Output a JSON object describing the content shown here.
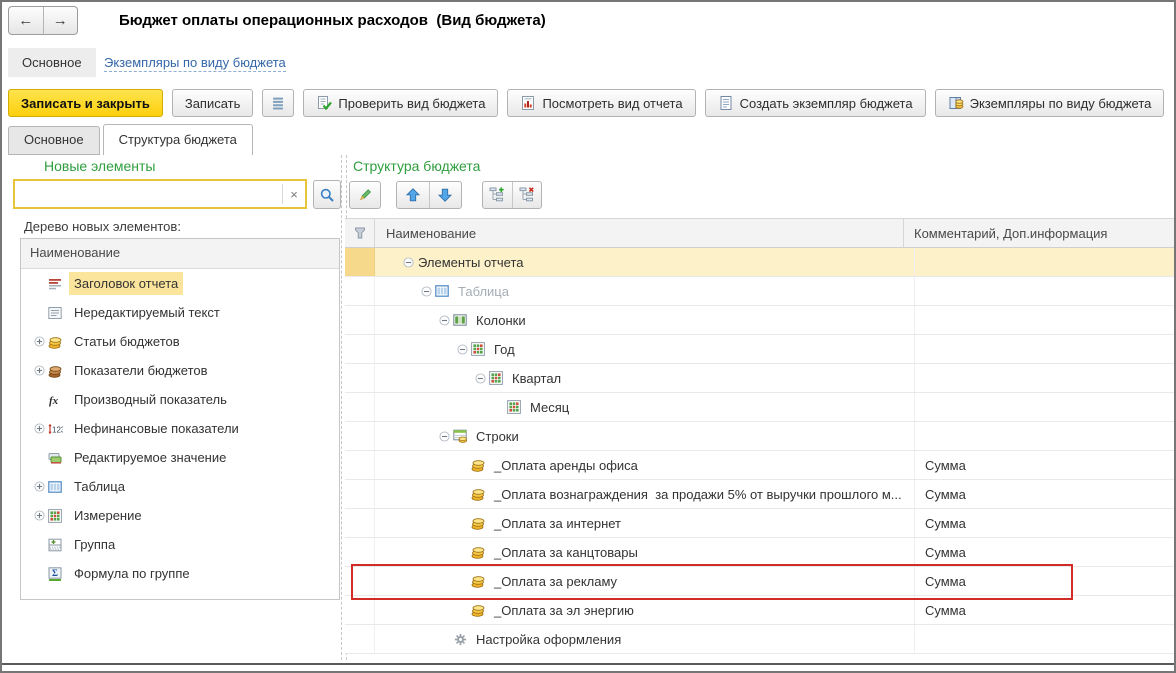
{
  "colors": {
    "accent_green": "#2f9e3f",
    "selection_yellow": "#fbe49c",
    "row_selection": "#fdf1c9",
    "row_selection_dark": "#f6d98b",
    "highlight_border": "#d22c26",
    "primary_button_yellow": "#fdd00e",
    "link_blue": "#3567a8",
    "search_border_yellow": "#e6c43c"
  },
  "icons": {
    "back-icon": "←",
    "forward-icon": "→",
    "star-icon": "☆",
    "clear-icon": "×"
  },
  "window": {
    "title": "Бюджет оплаты операционных расходов  (Вид бюджета)"
  },
  "linkbar": {
    "section_tab": "Основное",
    "link": "Экземпляры по виду бюджета"
  },
  "toolbar": {
    "buttons": [
      {
        "name": "save-close-button",
        "label": "Записать и закрыть",
        "primary": true
      },
      {
        "name": "save-button",
        "label": "Записать"
      },
      {
        "name": "list-menu-button",
        "icon": "menu-lines-icon"
      },
      {
        "name": "check-budget-view-button",
        "label": "Проверить вид бюджета",
        "icon": "check-doc-icon"
      },
      {
        "name": "view-report-button",
        "label": "Посмотреть вид отчета",
        "icon": "chart-doc-icon"
      },
      {
        "name": "create-budget-instance-button",
        "label": "Создать экземпляр бюджета",
        "icon": "doc-icon"
      },
      {
        "name": "budget-instances-button",
        "label": "Экземпляры по виду бюджета",
        "icon": "book-coins-icon"
      }
    ]
  },
  "tabs": [
    {
      "label": "Основное",
      "active": false
    },
    {
      "label": "Структура бюджета",
      "active": true
    }
  ],
  "left_panel": {
    "title": "Новые элементы",
    "search": {
      "value": "",
      "placeholder": ""
    },
    "tree_label": "Дерево новых элементов:",
    "column_header": "Наименование",
    "items": [
      {
        "label": "Заголовок отчета",
        "icon": "report-header-icon",
        "expandable": false,
        "selected": true
      },
      {
        "label": "Нередактируемый текст",
        "icon": "static-text-icon",
        "expandable": false
      },
      {
        "label": "Статьи бюджетов",
        "icon": "coins-yellow-icon",
        "expandable": true
      },
      {
        "label": "Показатели бюджетов",
        "icon": "coins-brown-icon",
        "expandable": true
      },
      {
        "label": "Производный показатель",
        "icon": "fx-icon",
        "expandable": false
      },
      {
        "label": "Нефинансовые показатели",
        "icon": "numbers-icon",
        "expandable": true
      },
      {
        "label": "Редактируемое значение",
        "icon": "editable-value-icon",
        "expandable": false
      },
      {
        "label": "Таблица",
        "icon": "table-blue-icon",
        "expandable": true
      },
      {
        "label": "Измерение",
        "icon": "dimension-icon",
        "expandable": true
      },
      {
        "label": "Группа",
        "icon": "group-icon",
        "expandable": false
      },
      {
        "label": "Формула по группе",
        "icon": "sigma-icon",
        "expandable": false
      }
    ]
  },
  "right_panel": {
    "title": "Структура бюджета",
    "toolbar_icons": [
      "pencil-icon",
      "arrow-up-icon",
      "arrow-down-icon",
      "tree-add-icon",
      "tree-delete-icon"
    ],
    "columns": [
      "Наименование",
      "Комментарий, Доп.информация"
    ],
    "rows": [
      {
        "label": "Элементы отчета",
        "level": 0,
        "expander": true,
        "icon": null,
        "comment": "",
        "selected": true
      },
      {
        "label": "Таблица",
        "level": 1,
        "expander": true,
        "icon": "table-blue-icon",
        "comment": "",
        "muted": true
      },
      {
        "label": "Колонки",
        "level": 2,
        "expander": true,
        "icon": "table-green-icon",
        "comment": ""
      },
      {
        "label": "Год",
        "level": 3,
        "expander": true,
        "icon": "dimension-icon",
        "comment": ""
      },
      {
        "label": "Квартал",
        "level": 4,
        "expander": true,
        "icon": "dimension-icon",
        "comment": ""
      },
      {
        "label": "Месяц",
        "level": 5,
        "expander": false,
        "icon": "dimension-icon",
        "comment": ""
      },
      {
        "label": "Строки",
        "level": 2,
        "expander": true,
        "icon": "rows-icon",
        "comment": ""
      },
      {
        "label": "_Оплата аренды офиса",
        "level": 3,
        "expander": false,
        "icon": "coins-yellow-icon",
        "comment": "Сумма"
      },
      {
        "label": "_Оплата вознаграждения  за продажи 5% от выручки прошлого м...",
        "level": 3,
        "expander": false,
        "icon": "coins-yellow-icon",
        "comment": "Сумма"
      },
      {
        "label": "_Оплата за интернет",
        "level": 3,
        "expander": false,
        "icon": "coins-yellow-icon",
        "comment": "Сумма"
      },
      {
        "label": "_Оплата за канцтовары",
        "level": 3,
        "expander": false,
        "icon": "coins-yellow-icon",
        "comment": "Сумма"
      },
      {
        "label": "_Оплата за рекламу",
        "level": 3,
        "expander": false,
        "icon": "coins-yellow-icon",
        "comment": "Сумма",
        "highlighted": true
      },
      {
        "label": "_Оплата за эл энергию",
        "level": 3,
        "expander": false,
        "icon": "coins-yellow-icon",
        "comment": "Сумма"
      },
      {
        "label": "Настройка оформления",
        "level": 2,
        "expander": false,
        "icon": "gear-icon",
        "comment": ""
      }
    ]
  }
}
